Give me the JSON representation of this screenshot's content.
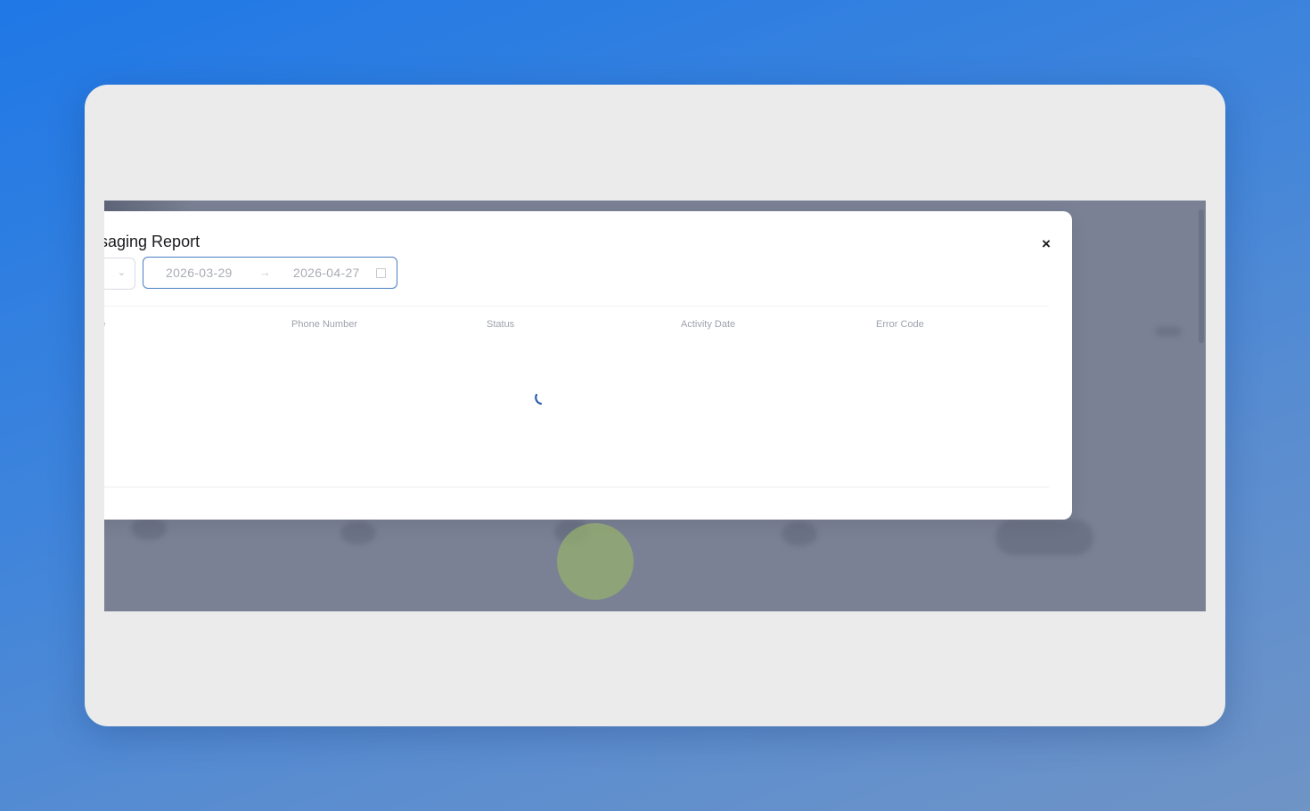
{
  "modal": {
    "title": "ssaging Report",
    "close_label": "×",
    "date_range": {
      "start": "2026-03-29",
      "separator": "→",
      "end": "2026-04-27"
    },
    "table": {
      "columns": [
        "ame",
        "Phone Number",
        "Status",
        "Activity Date",
        "Error Code"
      ],
      "state": "loading"
    }
  },
  "icons": {
    "close": "close-icon",
    "dropdown": "chevron-down-icon",
    "calendar": "calendar-icon",
    "arrow": "arrow-right-icon",
    "spinner": "loading-spinner-icon"
  },
  "colors": {
    "background_gradient_start": "#1f78e6",
    "background_gradient_end": "#6f94c6",
    "card": "#ebebec",
    "overlay": "#7a8194",
    "picker_border": "#4a7fc2",
    "spinner": "#2f5fae",
    "cursor_halo": "#96af6e"
  }
}
